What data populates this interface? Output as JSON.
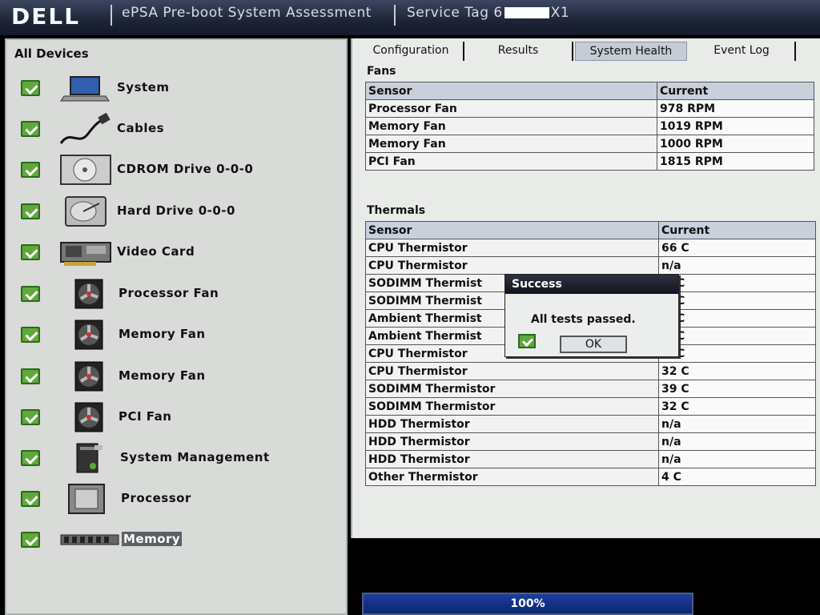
{
  "titlebar": {
    "logo": "DELL",
    "app_title": "ePSA Pre-boot System Assessment",
    "service_tag_label": "Service Tag",
    "service_tag_prefix": "6",
    "service_tag_suffix": "X1"
  },
  "left_panel": {
    "title": "All Devices",
    "devices": [
      {
        "label": "System",
        "icon": "laptop-icon",
        "status": "passed"
      },
      {
        "label": "Cables",
        "icon": "cable-icon",
        "status": "passed"
      },
      {
        "label": "CDROM Drive 0-0-0",
        "icon": "cdrom-icon",
        "status": "passed"
      },
      {
        "label": "Hard Drive 0-0-0",
        "icon": "hard-drive-icon",
        "status": "passed"
      },
      {
        "label": "Video Card",
        "icon": "video-card-icon",
        "status": "passed"
      },
      {
        "label": "Processor Fan",
        "icon": "fan-icon",
        "status": "passed"
      },
      {
        "label": "Memory Fan",
        "icon": "fan-icon",
        "status": "passed"
      },
      {
        "label": "Memory Fan",
        "icon": "fan-icon",
        "status": "passed"
      },
      {
        "label": "PCI Fan",
        "icon": "fan-icon",
        "status": "passed"
      },
      {
        "label": "System Management",
        "icon": "system-management-icon",
        "status": "passed"
      },
      {
        "label": "Processor",
        "icon": "processor-icon",
        "status": "passed"
      },
      {
        "label": "Memory",
        "icon": "memory-icon",
        "status": "passed"
      }
    ]
  },
  "tabs": [
    {
      "label": "Configuration"
    },
    {
      "label": "Results"
    },
    {
      "label": "System Health"
    },
    {
      "label": "Event Log"
    }
  ],
  "fans": {
    "title": "Fans",
    "col_sensor": "Sensor",
    "col_current": "Current",
    "rows": [
      {
        "sensor": "Processor Fan",
        "current": "978 RPM"
      },
      {
        "sensor": "Memory Fan",
        "current": "1019 RPM"
      },
      {
        "sensor": "Memory Fan",
        "current": "1000 RPM"
      },
      {
        "sensor": "PCI Fan",
        "current": "1815 RPM"
      }
    ]
  },
  "thermals": {
    "title": "Thermals",
    "col_sensor": "Sensor",
    "col_current": "Current",
    "rows": [
      {
        "sensor": "CPU Thermistor",
        "current": "66 C"
      },
      {
        "sensor": "CPU Thermistor",
        "current": "n/a"
      },
      {
        "sensor": "SODIMM Thermist",
        "current": "C"
      },
      {
        "sensor": "SODIMM Thermist",
        "current": "C"
      },
      {
        "sensor": "Ambient Thermist",
        "current": "C"
      },
      {
        "sensor": "Ambient Thermist",
        "current": "C"
      },
      {
        "sensor": "CPU Thermistor",
        "current": "C"
      },
      {
        "sensor": "CPU Thermistor",
        "current": "32 C"
      },
      {
        "sensor": "SODIMM Thermistor",
        "current": "39 C"
      },
      {
        "sensor": "SODIMM Thermistor",
        "current": "32 C"
      },
      {
        "sensor": "HDD Thermistor",
        "current": "n/a"
      },
      {
        "sensor": "HDD Thermistor",
        "current": "n/a"
      },
      {
        "sensor": "HDD Thermistor",
        "current": "n/a"
      },
      {
        "sensor": "Other Thermistor",
        "current": "4 C"
      }
    ]
  },
  "dialog": {
    "title": "Success",
    "message": "All tests passed.",
    "ok_label": "OK"
  },
  "progress": {
    "label": "100%",
    "value": 1.0
  }
}
